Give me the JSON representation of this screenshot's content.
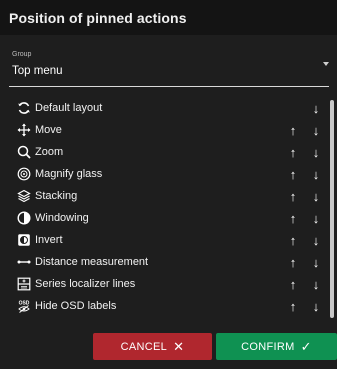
{
  "dialog": {
    "title": "Position of pinned actions"
  },
  "group": {
    "label": "Group",
    "value": "Top menu"
  },
  "actions": [
    {
      "label": "Default layout",
      "icon": "reset-layout-icon",
      "up": false,
      "down": true
    },
    {
      "label": "Move",
      "icon": "move-icon",
      "up": true,
      "down": true
    },
    {
      "label": "Zoom",
      "icon": "zoom-icon",
      "up": true,
      "down": true
    },
    {
      "label": "Magnify glass",
      "icon": "magnify-glass-icon",
      "up": true,
      "down": true
    },
    {
      "label": "Stacking",
      "icon": "stacking-icon",
      "up": true,
      "down": true
    },
    {
      "label": "Windowing",
      "icon": "windowing-icon",
      "up": true,
      "down": true
    },
    {
      "label": "Invert",
      "icon": "invert-icon",
      "up": true,
      "down": true
    },
    {
      "label": "Distance measurement",
      "icon": "distance-measurement-icon",
      "up": true,
      "down": true
    },
    {
      "label": "Series localizer lines",
      "icon": "series-localizer-icon",
      "up": true,
      "down": true
    },
    {
      "label": "Hide OSD labels",
      "icon": "hide-osd-icon",
      "up": true,
      "down": true
    }
  ],
  "arrows": {
    "up": "↑",
    "down": "↓"
  },
  "buttons": {
    "cancel": "CANCEL",
    "cancel_glyph": "✕",
    "confirm": "CONFIRM",
    "confirm_glyph": "✓"
  },
  "colors": {
    "cancel": "#b0272e",
    "confirm": "#0f9152",
    "background": "#1e1e1e",
    "header": "#141414"
  }
}
